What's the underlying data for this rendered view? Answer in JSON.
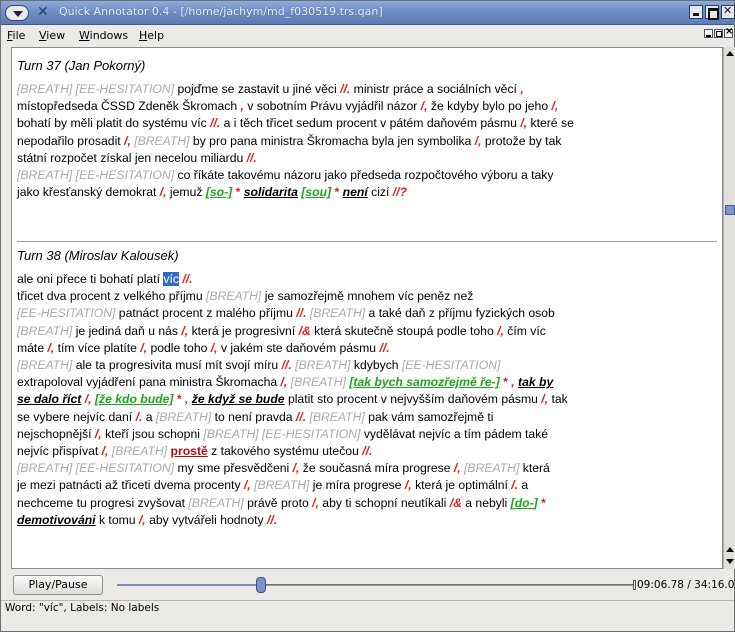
{
  "window": {
    "title": "Quick Annotator 0.4 - [/home/jachym/md_f030519.trs.qan]"
  },
  "menu": {
    "items": [
      {
        "pre": "",
        "u": "F",
        "post": "ile"
      },
      {
        "pre": "",
        "u": "V",
        "post": "iew"
      },
      {
        "pre": "",
        "u": "W",
        "post": "indows"
      },
      {
        "pre": "",
        "u": "H",
        "post": "elp"
      }
    ]
  },
  "turns": [
    {
      "header": "Turn 37 (Jan Pokorný)",
      "lines": [
        [
          {
            "t": "[BREATH] [EE-HESITATION]",
            "s": "tg"
          },
          {
            "t": " pojďme se zastavit u jiné věci ",
            "s": ""
          },
          {
            "t": "//.",
            "s": "sl"
          },
          {
            "t": " ministr práce a sociálních věcí ",
            "s": ""
          },
          {
            "t": ",",
            "s": "qm"
          }
        ],
        [
          {
            "t": "místopředseda ČSSD Zdeněk Škromach ",
            "s": ""
          },
          {
            "t": ",",
            "s": "qm"
          },
          {
            "t": " v sobotním Právu vyjádřil názor ",
            "s": ""
          },
          {
            "t": "/,",
            "s": "sl"
          },
          {
            "t": " že kdyby bylo po jeho ",
            "s": ""
          },
          {
            "t": "/,",
            "s": "sl"
          }
        ],
        [
          {
            "t": "bohatí by měli platit do systému víc ",
            "s": ""
          },
          {
            "t": "//.",
            "s": "sl"
          },
          {
            "t": " a i těch třicet sedum procent v pátém daňovém pásmu ",
            "s": ""
          },
          {
            "t": "/,",
            "s": "sl"
          },
          {
            "t": " které se",
            "s": ""
          }
        ],
        [
          {
            "t": "nepodařilo prosadit ",
            "s": ""
          },
          {
            "t": "/,",
            "s": "sl"
          },
          {
            "t": " [BREATH]",
            "s": "tg"
          },
          {
            "t": " by pro pana ministra Škromacha byla jen symbolika ",
            "s": ""
          },
          {
            "t": "/,",
            "s": "sl"
          },
          {
            "t": " protože by tak",
            "s": ""
          }
        ],
        [
          {
            "t": "státní rozpočet získal jen necelou miliardu ",
            "s": ""
          },
          {
            "t": "//.",
            "s": "sl"
          }
        ],
        [
          {
            "t": "[BREATH] [EE-HESITATION]",
            "s": "tg"
          },
          {
            "t": " co říkáte takovému názoru jako předseda rozpočtového výboru a taky",
            "s": ""
          }
        ],
        [
          {
            "t": "jako křesťanský demokrat ",
            "s": ""
          },
          {
            "t": "/,",
            "s": "sl"
          },
          {
            "t": " jemuž ",
            "s": ""
          },
          {
            "t": "[so-]",
            "s": "gb"
          },
          {
            "t": " * ",
            "s": "ast"
          },
          {
            "t": "solidarita",
            "s": "bu"
          },
          {
            "t": " ",
            "s": ""
          },
          {
            "t": "[sou]",
            "s": "gb"
          },
          {
            "t": " * ",
            "s": "ast"
          },
          {
            "t": "není",
            "s": "bu"
          },
          {
            "t": " cizí ",
            "s": ""
          },
          {
            "t": "//?",
            "s": "sl"
          }
        ]
      ]
    },
    {
      "header": "Turn 38 (Miroslav Kalousek)",
      "lines": [
        [
          {
            "t": "ale oni přece ti bohatí platí ",
            "s": ""
          },
          {
            "t": "víc",
            "s": "selected"
          },
          {
            "t": " ",
            "s": ""
          },
          {
            "t": "//.",
            "s": "sl"
          }
        ],
        [
          {
            "t": "třicet dva procent z velkého příjmu ",
            "s": ""
          },
          {
            "t": "[BREATH]",
            "s": "tg"
          },
          {
            "t": " je samozřejmě mnohem víc peněz než",
            "s": ""
          }
        ],
        [
          {
            "t": "[EE-HESITATION]",
            "s": "tg"
          },
          {
            "t": " patnáct procent z malého příjmu ",
            "s": ""
          },
          {
            "t": "//.",
            "s": "sl"
          },
          {
            "t": " [BREATH]",
            "s": "tg"
          },
          {
            "t": " a také daň z příjmu fyzických osob",
            "s": ""
          }
        ],
        [
          {
            "t": "[BREATH]",
            "s": "tg"
          },
          {
            "t": " je jediná daň u nás ",
            "s": ""
          },
          {
            "t": "/,",
            "s": "sl"
          },
          {
            "t": " která je progresivní ",
            "s": ""
          },
          {
            "t": "/&",
            "s": "sl"
          },
          {
            "t": " která skutečně stoupá podle toho ",
            "s": ""
          },
          {
            "t": "/,",
            "s": "sl"
          },
          {
            "t": " čím víc",
            "s": ""
          }
        ],
        [
          {
            "t": "máte ",
            "s": ""
          },
          {
            "t": "/,",
            "s": "sl"
          },
          {
            "t": " tím více platíte ",
            "s": ""
          },
          {
            "t": "/,",
            "s": "sl"
          },
          {
            "t": " podle toho ",
            "s": ""
          },
          {
            "t": "/,",
            "s": "sl"
          },
          {
            "t": " v jakém ste daňovém pásmu ",
            "s": ""
          },
          {
            "t": "//.",
            "s": "sl"
          }
        ],
        [
          {
            "t": "[BREATH]",
            "s": "tg"
          },
          {
            "t": " ale ta progresivita musí mít svojí míru ",
            "s": ""
          },
          {
            "t": "//.",
            "s": "sl"
          },
          {
            "t": " [BREATH]",
            "s": "tg"
          },
          {
            "t": " kdybych ",
            "s": ""
          },
          {
            "t": "[EE-HESITATION]",
            "s": "tg"
          }
        ],
        [
          {
            "t": "extrapoloval vyjádření pana ministra Škromacha ",
            "s": ""
          },
          {
            "t": "/,",
            "s": "sl"
          },
          {
            "t": " [BREATH]",
            "s": "tg"
          },
          {
            "t": " ",
            "s": ""
          },
          {
            "t": "[tak bych samozřejmě ře-]",
            "s": "gb"
          },
          {
            "t": " * ",
            "s": "ast"
          },
          {
            "t": ",",
            "s": "qm"
          },
          {
            "t": " ",
            "s": ""
          },
          {
            "t": "tak by",
            "s": "bu"
          }
        ],
        [
          {
            "t": "se dalo říct",
            "s": "bu"
          },
          {
            "t": " ",
            "s": ""
          },
          {
            "t": "/,",
            "s": "sl"
          },
          {
            "t": " ",
            "s": ""
          },
          {
            "t": "[že kdo bude]",
            "s": "gb"
          },
          {
            "t": " * ",
            "s": "ast"
          },
          {
            "t": ",",
            "s": "qm"
          },
          {
            "t": " ",
            "s": ""
          },
          {
            "t": "že když se bude",
            "s": "bu"
          },
          {
            "t": " platit sto procent v nejvyšším daňovém pásmu ",
            "s": ""
          },
          {
            "t": "/,",
            "s": "sl"
          },
          {
            "t": " tak",
            "s": ""
          }
        ],
        [
          {
            "t": "se vybere nejvíc daní ",
            "s": ""
          },
          {
            "t": "/.",
            "s": "sl"
          },
          {
            "t": " a ",
            "s": ""
          },
          {
            "t": "[BREATH]",
            "s": "tg"
          },
          {
            "t": " to není pravda ",
            "s": ""
          },
          {
            "t": "//.",
            "s": "sl"
          },
          {
            "t": " [BREATH]",
            "s": "tg"
          },
          {
            "t": " pak vám samozřejmě ti",
            "s": ""
          }
        ],
        [
          {
            "t": "nejschopnější ",
            "s": ""
          },
          {
            "t": "/,",
            "s": "sl"
          },
          {
            "t": " kteří jsou schopni ",
            "s": ""
          },
          {
            "t": "[BREATH] [EE-HESITATION]",
            "s": "tg"
          },
          {
            "t": " vydělávat nejvíc a tím pádem také",
            "s": ""
          }
        ],
        [
          {
            "t": "nejvíc přispívat ",
            "s": ""
          },
          {
            "t": "/,",
            "s": "sl"
          },
          {
            "t": " [BREATH]",
            "s": "tg"
          },
          {
            "t": " ",
            "s": ""
          },
          {
            "t": "prostě",
            "s": "red-under"
          },
          {
            "t": " z takového systému utečou ",
            "s": ""
          },
          {
            "t": "//.",
            "s": "sl"
          }
        ],
        [
          {
            "t": "[BREATH] [EE-HESITATION]",
            "s": "tg"
          },
          {
            "t": " my sme přesvědčeni ",
            "s": ""
          },
          {
            "t": "/,",
            "s": "sl"
          },
          {
            "t": " že současná míra progrese ",
            "s": ""
          },
          {
            "t": "/,",
            "s": "sl"
          },
          {
            "t": " [BREATH]",
            "s": "tg"
          },
          {
            "t": " která",
            "s": ""
          }
        ],
        [
          {
            "t": "je mezi patnácti až třiceti dvema procenty ",
            "s": ""
          },
          {
            "t": "/,",
            "s": "sl"
          },
          {
            "t": " [BREATH]",
            "s": "tg"
          },
          {
            "t": " je míra progrese ",
            "s": ""
          },
          {
            "t": "/,",
            "s": "sl"
          },
          {
            "t": " která je optimální ",
            "s": ""
          },
          {
            "t": "/.",
            "s": "sl"
          },
          {
            "t": " a",
            "s": ""
          }
        ],
        [
          {
            "t": "nechceme tu progresi zvyšovat ",
            "s": ""
          },
          {
            "t": "[BREATH]",
            "s": "tg"
          },
          {
            "t": " právě proto ",
            "s": ""
          },
          {
            "t": "/,",
            "s": "sl"
          },
          {
            "t": " aby ti schopní neutíkali ",
            "s": ""
          },
          {
            "t": "/&",
            "s": "sl"
          },
          {
            "t": " a nebyli ",
            "s": ""
          },
          {
            "t": "[do-]",
            "s": "gb"
          },
          {
            "t": " *",
            "s": "ast"
          }
        ],
        [
          {
            "t": "demotivováni",
            "s": "bu"
          },
          {
            "t": " k tomu ",
            "s": ""
          },
          {
            "t": "/,",
            "s": "sl"
          },
          {
            "t": " aby vytvářeli hodnoty ",
            "s": ""
          },
          {
            "t": "//.",
            "s": "sl"
          }
        ]
      ]
    }
  ],
  "player": {
    "play_label": "Play/Pause",
    "progress_fraction": 0.28,
    "time": "09:06.78 / 34:16.01"
  },
  "status": {
    "text": "Word: \"víc\", Labels: No labels"
  },
  "colors": {
    "tag_gray": "#a9a9a9",
    "slash_red": "#e0201a",
    "bracket_green": "#1da51d",
    "selection_blue": "#2f6bc7",
    "titlebar_blue": "#6d8cc4"
  }
}
